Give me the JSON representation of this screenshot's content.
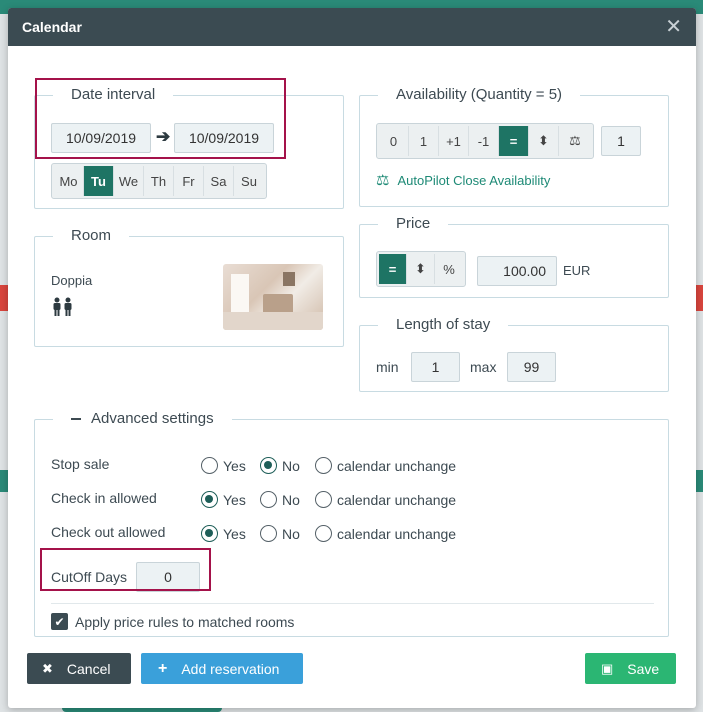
{
  "modal": {
    "title": "Calendar"
  },
  "date_interval": {
    "legend": "Date interval",
    "from": "10/09/2019",
    "to": "10/09/2019",
    "days": [
      "Mo",
      "Tu",
      "We",
      "Th",
      "Fr",
      "Sa",
      "Su"
    ],
    "active_day": "Tu"
  },
  "availability": {
    "legend": "Availability (Quantity = 5)",
    "buttons": [
      "0",
      "1",
      "+1",
      "-1",
      "=",
      "⬍",
      "⚖"
    ],
    "active": "=",
    "value": "1",
    "autopilot_label": "AutoPilot Close Availability"
  },
  "room": {
    "legend": "Room",
    "name": "Doppia",
    "occupancy_icon": "two-persons-icon"
  },
  "price": {
    "legend": "Price",
    "buttons": [
      "=",
      "⬍",
      "%"
    ],
    "active": "=",
    "value": "100.00",
    "currency": "EUR"
  },
  "length_of_stay": {
    "legend": "Length of stay",
    "min_label": "min",
    "min": "1",
    "max_label": "max",
    "max": "99"
  },
  "advanced": {
    "legend": "Advanced settings",
    "stop_sale": {
      "label": "Stop sale",
      "selected": "No"
    },
    "check_in": {
      "label": "Check in allowed",
      "selected": "Yes"
    },
    "check_out": {
      "label": "Check out allowed",
      "selected": "Yes"
    },
    "options": {
      "yes": "Yes",
      "no": "No",
      "unchanged": "calendar unchange"
    },
    "cutoff": {
      "label": "CutOff Days",
      "value": "0"
    },
    "apply_rules": {
      "label": "Apply price rules to matched rooms",
      "checked": true
    }
  },
  "footer": {
    "cancel": "Cancel",
    "add_reservation": "Add reservation",
    "save": "Save"
  },
  "colors": {
    "accent": "#1e7464",
    "header": "#3b4b52",
    "highlight": "#a4124a",
    "save": "#2bb673",
    "add": "#3aa0da",
    "cancel": "#3b4b52"
  }
}
